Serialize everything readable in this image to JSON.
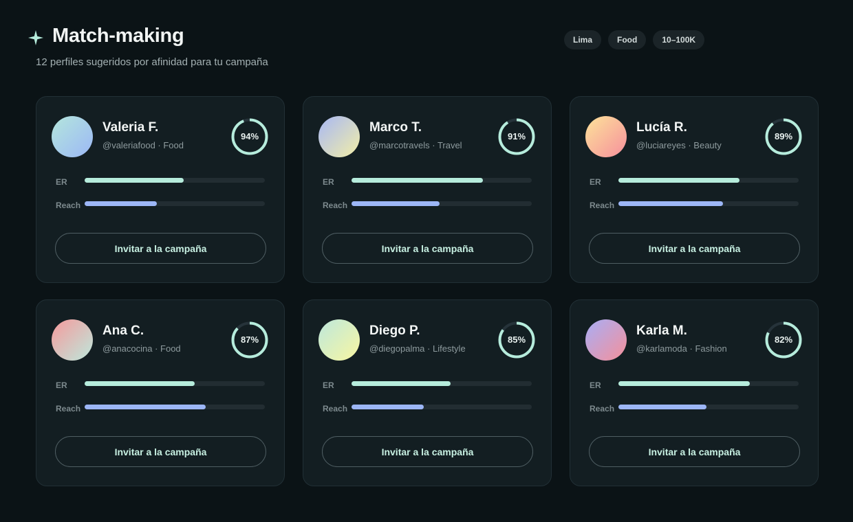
{
  "header": {
    "title": "Match-making",
    "subtitle": "12 perfiles sugeridos por afinidad para tu campaña",
    "icon": "sparkle-icon"
  },
  "filters": [
    "Lima",
    "Food",
    "10–100K"
  ],
  "metric_labels": {
    "er": "ER",
    "reach": "Reach"
  },
  "colors": {
    "accent": "#b6ecdc",
    "reach_bar": "#9cb6f6",
    "background": "#0b1316",
    "card": "#131e22"
  },
  "profiles": [
    {
      "name": "Valeria F.",
      "handle": "@valeriafood",
      "category": "Food",
      "score": "94%",
      "score_value": 0.94,
      "er": 0.55,
      "reach": 0.4,
      "avatar_colors": [
        "#b4e6dc",
        "#9cb8f6"
      ],
      "cta": "Invitar a la campaña"
    },
    {
      "name": "Marco T.",
      "handle": "@marcotravels",
      "category": "Travel",
      "score": "91%",
      "score_value": 0.91,
      "er": 0.73,
      "reach": 0.49,
      "avatar_colors": [
        "#a8b8f4",
        "#f2eea8"
      ],
      "cta": "Invitar a la campaña"
    },
    {
      "name": "Lucía R.",
      "handle": "@luciareyes",
      "category": "Beauty",
      "score": "89%",
      "score_value": 0.89,
      "er": 0.67,
      "reach": 0.58,
      "avatar_colors": [
        "#fde39a",
        "#f6909c"
      ],
      "cta": "Invitar a la campaña"
    },
    {
      "name": "Ana C.",
      "handle": "@anacocina",
      "category": "Food",
      "score": "87%",
      "score_value": 0.87,
      "er": 0.61,
      "reach": 0.67,
      "avatar_colors": [
        "#f59a9c",
        "#bde8dc"
      ],
      "cta": "Invitar a la campaña"
    },
    {
      "name": "Diego P.",
      "handle": "@diegopalma",
      "category": "Lifestyle",
      "score": "85%",
      "score_value": 0.85,
      "er": 0.55,
      "reach": 0.4,
      "avatar_colors": [
        "#bde8dc",
        "#f8f6a2"
      ],
      "cta": "Invitar a la campaña"
    },
    {
      "name": "Karla M.",
      "handle": "@karlamoda",
      "category": "Fashion",
      "score": "82%",
      "score_value": 0.82,
      "er": 0.73,
      "reach": 0.49,
      "avatar_colors": [
        "#a8aef6",
        "#f5909a"
      ],
      "cta": "Invitar a la campaña"
    }
  ]
}
